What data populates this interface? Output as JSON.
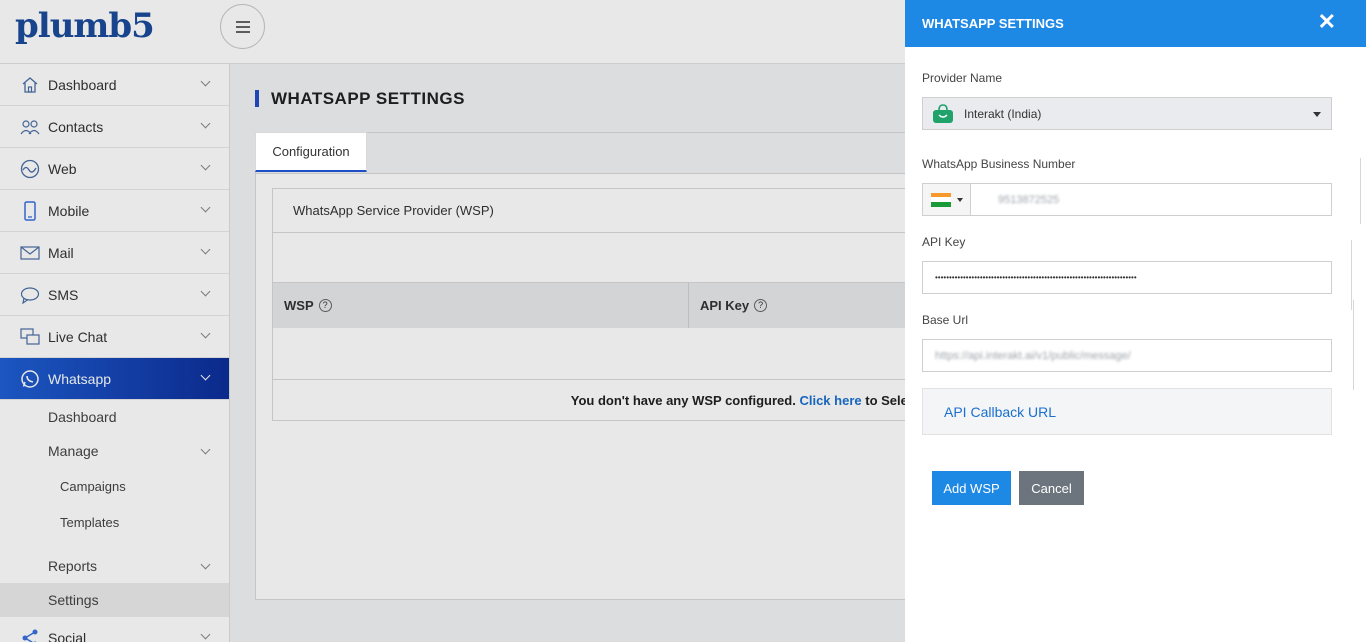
{
  "app": {
    "logo": "plumb5"
  },
  "sidebar": {
    "items": [
      {
        "label": "Dashboard"
      },
      {
        "label": "Contacts"
      },
      {
        "label": "Web"
      },
      {
        "label": "Mobile"
      },
      {
        "label": "Mail"
      },
      {
        "label": "SMS"
      },
      {
        "label": "Live Chat"
      },
      {
        "label": "Whatsapp"
      }
    ],
    "whatsapp_sub": {
      "dashboard": "Dashboard",
      "manage": "Manage",
      "campaigns": "Campaigns",
      "templates": "Templates",
      "reports": "Reports",
      "settings": "Settings"
    },
    "social": "Social"
  },
  "main": {
    "title": "WHATSAPP SETTINGS",
    "tab": "Configuration",
    "wsp_header": "WhatsApp Service Provider (WSP)",
    "col_wsp": "WSP",
    "col_api_key": "API Key",
    "help_glyph": "?",
    "empty_prefix": "You don't have any WSP configured. ",
    "empty_link": "Click here",
    "empty_suffix": " to Select p"
  },
  "drawer": {
    "title": "WHATSAPP SETTINGS",
    "close": "✕",
    "provider_label": "Provider Name",
    "provider_value": "Interakt (India)",
    "number_label": "WhatsApp Business Number",
    "number_value": "9513872525",
    "api_key_label": "API Key",
    "api_key_value": "••••••••••••••••••••••••••••••••••••••••••••••••••••••••••••••••••••••••",
    "base_url_label": "Base Url",
    "base_url_value": "https://api.interakt.ai/v1/public/message/",
    "callback_label": "API Callback URL",
    "add_button": "Add WSP",
    "cancel_button": "Cancel"
  },
  "colors": {
    "accent": "#1e88e5",
    "active_nav": "#1f5fd4",
    "link": "#1a6fd0",
    "interakt_green": "#20a26b"
  }
}
